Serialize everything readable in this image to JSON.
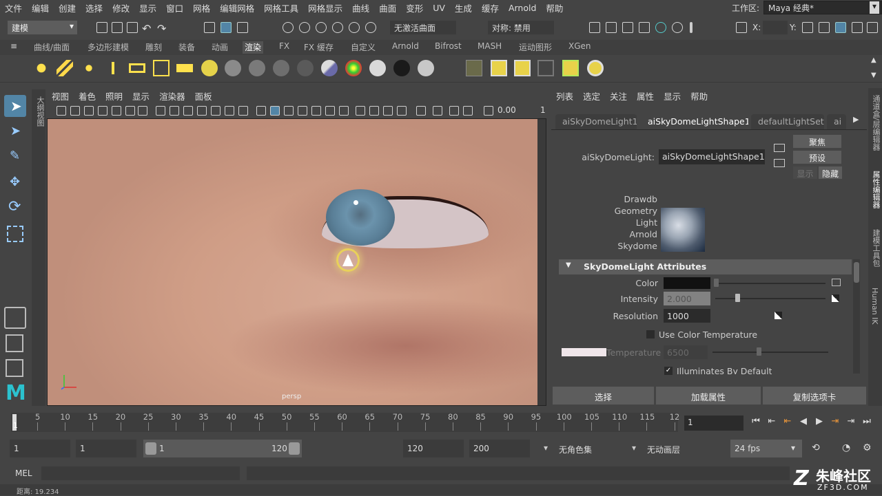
{
  "menubar": {
    "items": [
      "文件",
      "编辑",
      "创建",
      "选择",
      "修改",
      "显示",
      "窗口",
      "网格",
      "编辑网格",
      "网格工具",
      "网格显示",
      "曲线",
      "曲面",
      "变形",
      "UV",
      "生成",
      "缓存",
      "Arnold",
      "帮助"
    ],
    "workspace_label": "工作区:",
    "workspace_value": "Maya 经典*"
  },
  "statusline": {
    "mode": "建模",
    "live_surface": "无激活曲面",
    "symmetry": "对称: 禁用",
    "x_label": "X:",
    "y_label": "Y:"
  },
  "shelf": {
    "tabs": [
      "曲线/曲面",
      "多边形建模",
      "雕刻",
      "装备",
      "动画",
      "渲染",
      "FX",
      "FX 缓存",
      "自定义",
      "Arnold",
      "Bifrost",
      "MASH",
      "运动图形",
      "XGen"
    ],
    "active_tab": "渲染",
    "ball_colors": [
      "#8a8a8a",
      "#7a7a7a",
      "#6e6e6e",
      "#5a5a5a",
      "#d9d9d9",
      "#1a1a1a",
      "#c8c8c8"
    ]
  },
  "viewport": {
    "menu": [
      "视图",
      "着色",
      "照明",
      "显示",
      "渲染器",
      "面板"
    ],
    "exposure": "0.00",
    "gamma": "1",
    "camera": "persp",
    "side_tab": "大纲视图"
  },
  "attribute_editor": {
    "menu": [
      "列表",
      "选定",
      "关注",
      "属性",
      "显示",
      "帮助"
    ],
    "tabs": [
      "aiSkyDomeLight1",
      "aiSkyDomeLightShape1",
      "defaultLightSet",
      "ai"
    ],
    "active_tab": "aiSkyDomeLightShape1",
    "node_type_label": "aiSkyDomeLight:",
    "node_name": "aiSkyDomeLightShape1",
    "focus_btn": "聚焦",
    "preset_btn": "预设",
    "show_btn": "显示",
    "hide_btn": "隐藏",
    "classification": [
      "Drawdb",
      "Geometry",
      "Light",
      "Arnold",
      "Skydome"
    ],
    "section": "SkyDomeLight Attributes",
    "color_label": "Color",
    "color_value": "#111111",
    "intensity_label": "Intensity",
    "intensity_value": "2.000",
    "resolution_label": "Resolution",
    "resolution_value": "1000",
    "use_temp_label": "Use Color Temperature",
    "temperature_label": "Temperature",
    "temperature_value": "6500",
    "illuminates_label": "Illuminates By Default",
    "bottom_buttons": [
      "选择",
      "加载属性",
      "复制选项卡"
    ]
  },
  "right_tabs": [
    "通道盒/层编辑器",
    "属性编辑器",
    "建模工具包",
    "Human IK"
  ],
  "timeline": {
    "ticks": [
      "5",
      "10",
      "15",
      "20",
      "25",
      "30",
      "35",
      "40",
      "45",
      "50",
      "55",
      "60",
      "65",
      "70",
      "75",
      "80",
      "85",
      "90",
      "95",
      "100",
      "105",
      "110",
      "115",
      "12"
    ],
    "start_marker": "1",
    "current_frame": "1"
  },
  "range": {
    "start": "1",
    "playback_start": "1",
    "range_start": "1",
    "range_end": "120",
    "playback_end": "120",
    "end": "200",
    "character_set": "无角色集",
    "anim_layer": "无动画层",
    "fps": "24 fps"
  },
  "command": {
    "lang": "MEL"
  },
  "helpline": {
    "text": "距离: 19.234"
  },
  "watermark": {
    "title": "朱峰社区",
    "url": "ZF3D.COM"
  }
}
